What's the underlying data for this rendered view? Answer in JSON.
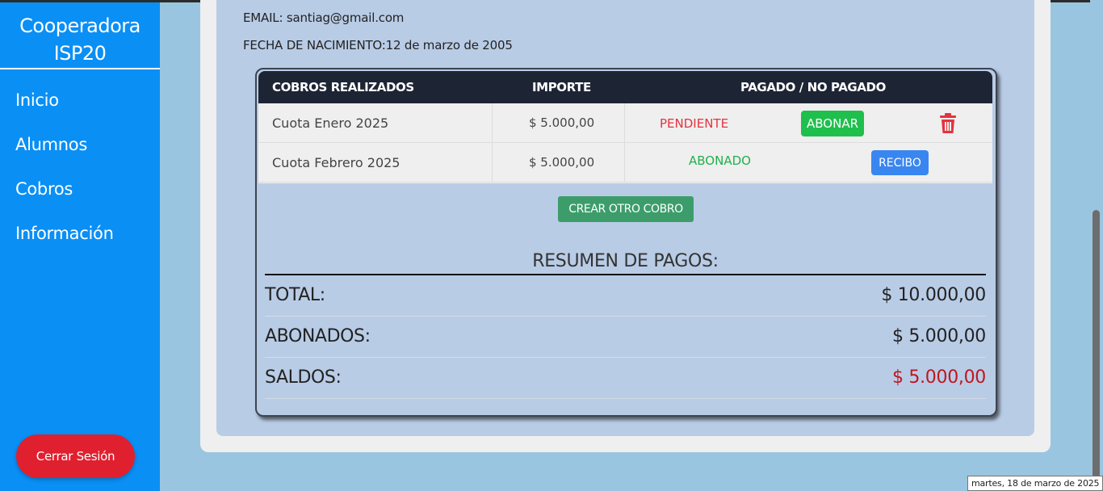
{
  "sidebar": {
    "brand_line1": "Cooperadora",
    "brand_line2": "ISP20",
    "items": [
      {
        "label": "Inicio"
      },
      {
        "label": "Alumnos"
      },
      {
        "label": "Cobros"
      },
      {
        "label": "Información"
      }
    ],
    "logout_label": "Cerrar Sesión"
  },
  "student": {
    "email": "EMAIL: santiag@gmail.com",
    "birth": "FECHA DE NACIMIENTO:12 de marzo de 2005"
  },
  "payments_table": {
    "headers": [
      "COBROS REALIZADOS",
      "IMPORTE",
      "PAGADO / NO PAGADO"
    ],
    "rows": [
      {
        "concept": "Cuota Enero 2025",
        "amount": "$ 5.000,00",
        "status": "PENDIENTE",
        "action": "ABONAR"
      },
      {
        "concept": "Cuota Febrero 2025",
        "amount": "$ 5.000,00",
        "status": "ABONADO",
        "action": "RECIBO"
      }
    ],
    "create_label": "CREAR OTRO COBRO"
  },
  "summary": {
    "title": "RESUMEN DE PAGOS:",
    "total_label": "TOTAL:",
    "total_value": "$ 10.000,00",
    "paid_label": "ABONADOS:",
    "paid_value": "$ 5.000,00",
    "balance_label": "SALDOS:",
    "balance_value": "$ 5.000,00"
  },
  "tooltip": "martes, 18 de marzo de 2025",
  "colors": {
    "sidebar": "#0a8ff5",
    "pending": "#e5333f",
    "paid": "#22b04d",
    "balance": "#c0161e"
  }
}
